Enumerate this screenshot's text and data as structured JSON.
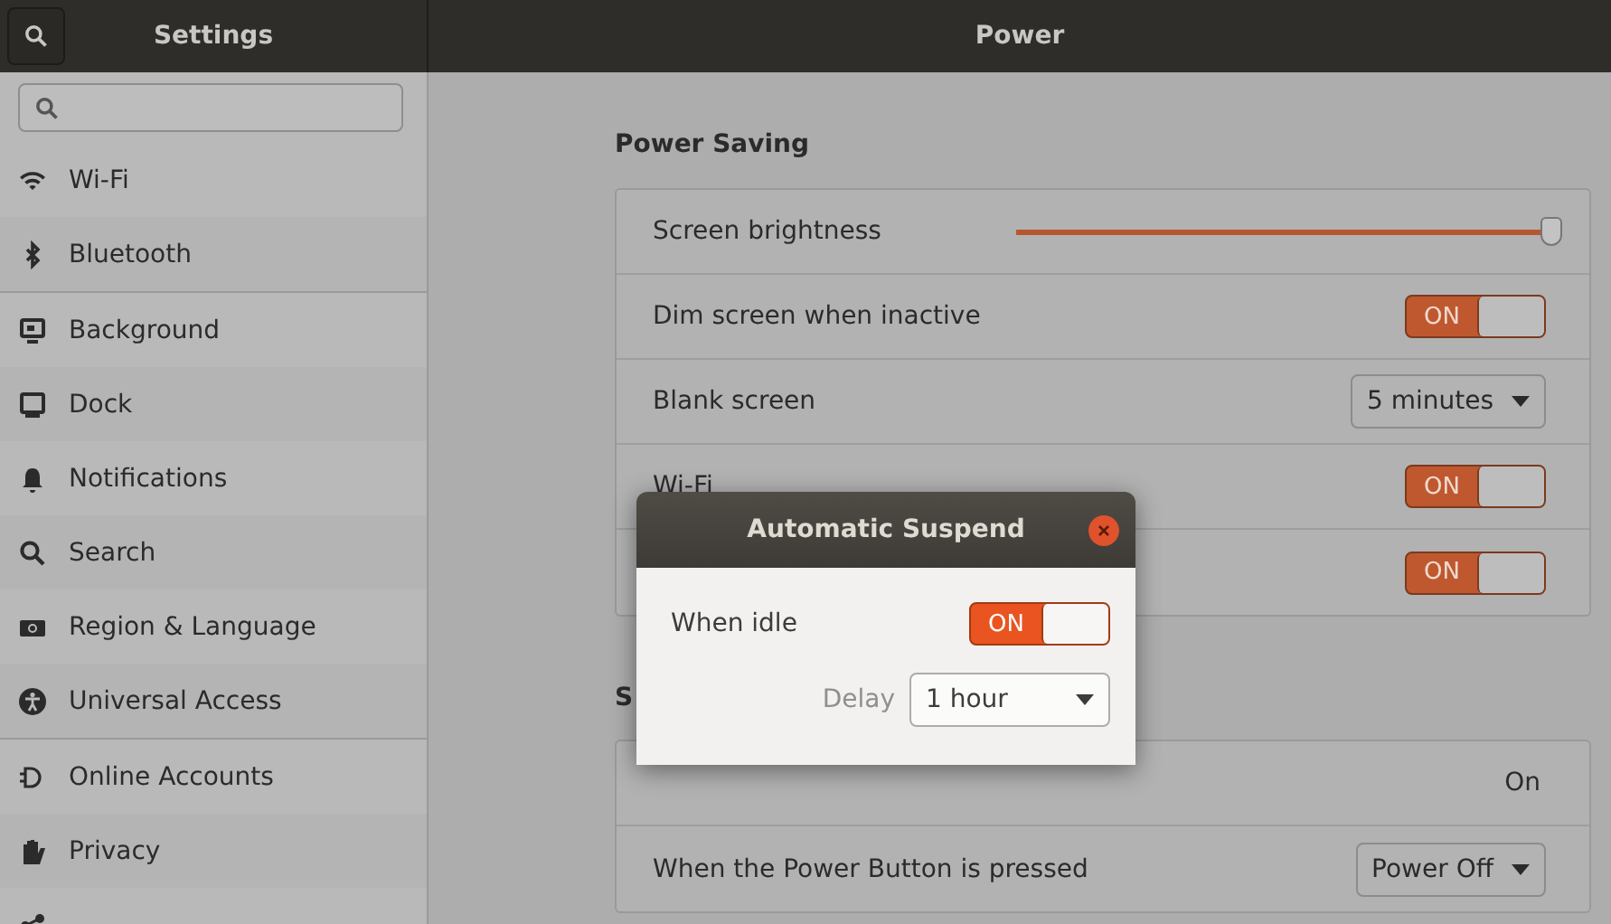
{
  "header": {
    "sidebar_title": "Settings",
    "title": "Power"
  },
  "sidebar": {
    "groups": [
      [
        {
          "label": "Wi-Fi"
        },
        {
          "label": "Bluetooth"
        }
      ],
      [
        {
          "label": "Background"
        },
        {
          "label": "Dock"
        },
        {
          "label": "Notifications"
        },
        {
          "label": "Search"
        },
        {
          "label": "Region & Language"
        },
        {
          "label": "Universal Access"
        }
      ],
      [
        {
          "label": "Online Accounts"
        },
        {
          "label": "Privacy"
        }
      ]
    ]
  },
  "sections": [
    {
      "title": "Power Saving",
      "rows": [
        {
          "kind": "slider",
          "label": "Screen brightness",
          "level": 0.98
        },
        {
          "kind": "switch",
          "label": "Dim screen when inactive",
          "on": true,
          "text": "ON"
        },
        {
          "kind": "dropdown",
          "label": "Blank screen",
          "value": "5 minutes"
        },
        {
          "kind": "switch",
          "label": "Wi-Fi",
          "on": true,
          "text": "ON"
        },
        {
          "kind": "switch",
          "on": true,
          "text": "ON"
        }
      ]
    },
    {
      "title": "S",
      "rows": [
        {
          "kind": "value",
          "value": "On"
        },
        {
          "kind": "dropdown",
          "label": "When the Power Button is pressed",
          "value": "Power Off"
        }
      ]
    }
  ],
  "dialog": {
    "title": "Automatic Suspend",
    "when_idle": {
      "label": "When idle",
      "on": true,
      "text": "ON"
    },
    "delay": {
      "label": "Delay",
      "value": "1 hour"
    }
  }
}
